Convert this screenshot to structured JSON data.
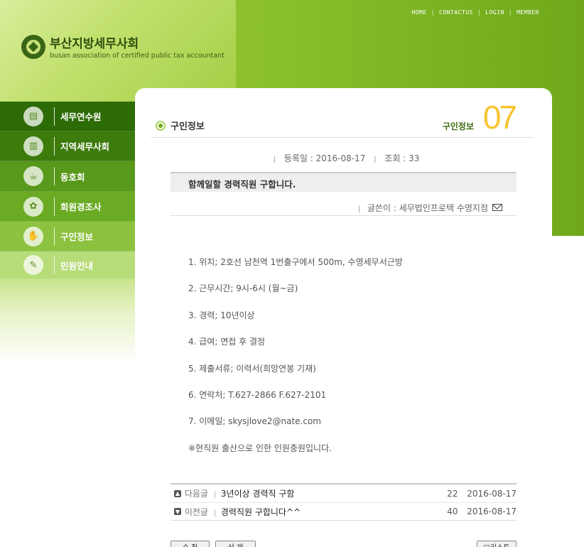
{
  "topnav": {
    "items": [
      "HOME",
      "CONTACTUS",
      "LOGIN",
      "MEMBER"
    ]
  },
  "logo": {
    "korean": "부산지방세무사회",
    "english": "busan association of certified public tax accountant"
  },
  "sidebar": {
    "items": [
      {
        "label": "세무연수원",
        "icon": "book-icon"
      },
      {
        "label": "지역세무사회",
        "icon": "building-icon"
      },
      {
        "label": "동호회",
        "icon": "coffee-icon"
      },
      {
        "label": "회원경조사",
        "icon": "flower-icon"
      },
      {
        "label": "구인정보",
        "icon": "handshake-icon"
      },
      {
        "label": "민원인내",
        "icon": "pen-icon"
      }
    ]
  },
  "page": {
    "title": "구인정보",
    "section_label": "구인정보",
    "section_number": "07"
  },
  "post": {
    "date_label": "등록일 : 2016-08-17",
    "views_label": "조회 : 33",
    "title": "함께일할 경력직원 구합니다.",
    "author_label": "글쓴이 : 세무법인프로택 수영지점",
    "body": [
      "1. 위치; 2호선 남천역 1번출구에서 500m, 수영세무서근방",
      "2. 근무시간; 9시-6시 (월~금)",
      "3. 경력; 10년이상",
      "4. 급여; 면접 후 결정",
      "5. 제출서류; 이력서(희망연봉 기재)",
      "6. 연락처; T.627-2866 F.627-2101",
      "7. 이메일; skysjlove2@nate.com",
      "※현직원 출산으로 인한 인원충원입니다."
    ]
  },
  "nav": {
    "next": {
      "kind": "다음글",
      "subject": "3년이상 경력직 구함",
      "hits": "22",
      "date": "2016-08-17"
    },
    "prev": {
      "kind": "이전글",
      "subject": "경력직원 구합니다^^",
      "hits": "40",
      "date": "2016-08-17"
    }
  },
  "buttons": {
    "edit": "수 정",
    "delete": "삭 제",
    "list": "□리스트"
  },
  "colors": {
    "accent_green": "#6fa81a",
    "number_yellow": "#f7c531"
  }
}
